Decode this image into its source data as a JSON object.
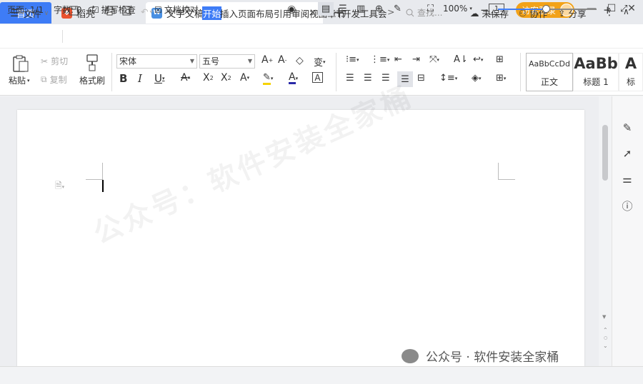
{
  "tabs": {
    "home": "首页",
    "daoke": "稻壳",
    "doc": "文字文稿1",
    "close": "×",
    "add": "+"
  },
  "titlebar": {
    "page_indicator": "1",
    "guest_login": "访客登录",
    "minimize": "—",
    "maximize": "☐",
    "close": "✕"
  },
  "menu": {
    "file": "文件",
    "items": [
      "开始",
      "插入",
      "页面",
      "布局",
      "引用",
      "审阅",
      "视图",
      "章节",
      "开发工具",
      "会"
    ],
    "more": ">",
    "search_placeholder": "查找...",
    "unsaved": "未保存",
    "collaborate": "协作",
    "share": "分享",
    "more_dots": "⋮",
    "collapse": "∧"
  },
  "ribbon": {
    "paste": "粘贴",
    "cut": "剪切",
    "copy": "复制",
    "format_painter": "格式刷",
    "font_name": "宋体",
    "font_size": "五号",
    "styles": [
      {
        "sample": "AaBbCcDd",
        "name": "正文"
      },
      {
        "sample": "AaBb",
        "name": "标题 1"
      },
      {
        "sample": "A",
        "name": "标"
      }
    ]
  },
  "document": {
    "watermark": "公众号：软件安装全家桶"
  },
  "statusbar": {
    "page": "页面: 1/1",
    "word_count": "字数: 0",
    "spell_check": "拼写检查",
    "doc_proof": "文档校对",
    "zoom": "100%",
    "zoom_value": 0.49
  },
  "overlay": {
    "wechat_watermark": "公众号 · 软件安装全家桶"
  },
  "colors": {
    "accent": "#3e7cf6",
    "guest": "#f2a219",
    "daoke": "#e9522e"
  }
}
